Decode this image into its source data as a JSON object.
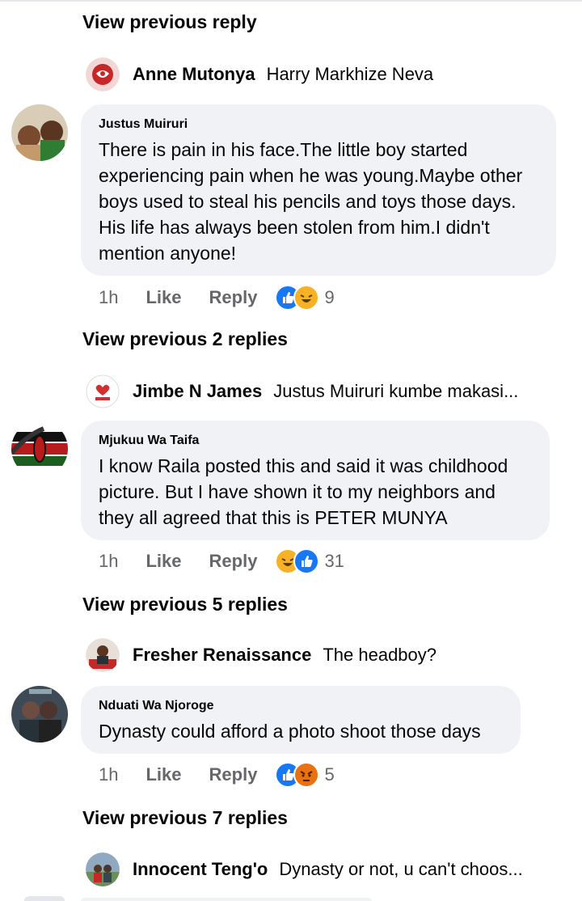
{
  "thread": {
    "view_prev_1": "View previous reply",
    "view_prev_2": "View previous 2 replies",
    "view_prev_3": "View previous 5 replies",
    "view_prev_4": "View previous 7 replies"
  },
  "replies": [
    {
      "name": "Anne Mutonya",
      "text": "Harry Markhize Neva"
    },
    {
      "name": "Jimbe N James",
      "text": "Justus Muiruri kumbe makasi..."
    },
    {
      "name": "Fresher Renaissance",
      "text": "The headboy?"
    },
    {
      "name": "Innocent Teng'o",
      "text": "Dynasty or not, u can't choos..."
    }
  ],
  "comments": [
    {
      "author": "Justus Muiruri",
      "body": "There is pain in his face.The little boy started experiencing pain when he was young.Maybe other boys used to steal his pencils and toys those days. His life has always been stolen from him.I didn't mention anyone!",
      "time": "1h",
      "like": "Like",
      "reply": "Reply",
      "count": "9",
      "reactions": [
        "like-icon",
        "haha-icon"
      ]
    },
    {
      "author": "Mjukuu Wa Taifa",
      "body": "I know Raila posted this and said it was childhood picture. But I have shown it to my neighbors and they all agreed that this is PETER MUNYA",
      "time": "1h",
      "like": "Like",
      "reply": "Reply",
      "count": "31",
      "reactions": [
        "haha-icon",
        "like-icon"
      ]
    },
    {
      "author": "Nduati Wa Njoroge",
      "body": "Dynasty could afford a photo shoot those days",
      "time": "1h",
      "like": "Like",
      "reply": "Reply",
      "count": "5",
      "reactions": [
        "like-icon",
        "angry-icon"
      ]
    }
  ],
  "colors": {
    "bubble": "#f0f2f5",
    "meta": "#65676b",
    "like": "#1877f2",
    "haha": "#f7b125",
    "angry": "#e9710f"
  }
}
